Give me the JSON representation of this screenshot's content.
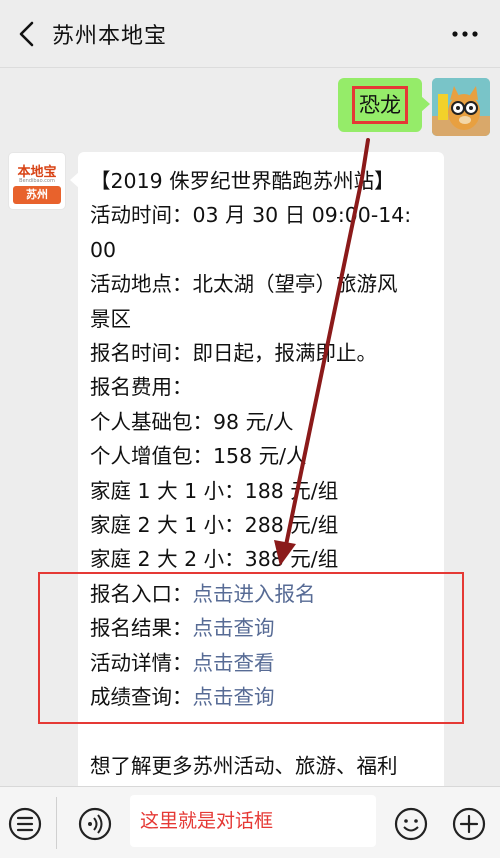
{
  "header": {
    "title": "苏州本地宝",
    "back_icon": "chevron-left-icon",
    "more_icon": "more-dots-icon"
  },
  "user_message": {
    "text": "恐龙",
    "avatar": "cartoon-cat-avatar"
  },
  "bot": {
    "avatar": {
      "brand_top": "本地宝",
      "brand_url": "Bendibao.com",
      "brand_city": "苏州"
    },
    "lines": [
      "【2019 侏罗纪世界酷跑苏州站】",
      "活动时间：03 月 30 日 09:00-14:",
      "00",
      "活动地点：北太湖（望亭）旅游风",
      "景区",
      "报名时间：即日起，报满即止。",
      "报名费用：",
      "个人基础包：98 元/人",
      "个人增值包：158 元/人",
      "家庭 1 大 1 小：188 元/组",
      "家庭 2 大 1 小：288 元/组",
      "家庭 2 大 2 小：388 元/组"
    ],
    "link_rows": [
      {
        "label": "报名入口：",
        "link": "点击进入报名"
      },
      {
        "label": "报名结果：",
        "link": "点击查询"
      },
      {
        "label": "活动详情：",
        "link": "点击查看"
      },
      {
        "label": "成绩查询：",
        "link": "点击查询"
      }
    ],
    "footer_line": "想了解更多苏州活动、旅游、福利"
  },
  "input": {
    "annotation_text": "这里就是对话框"
  },
  "colors": {
    "user_bubble": "#95ec69",
    "link": "#576b95",
    "annotation_red": "#e53935",
    "arrow": "#8b1a1a"
  }
}
